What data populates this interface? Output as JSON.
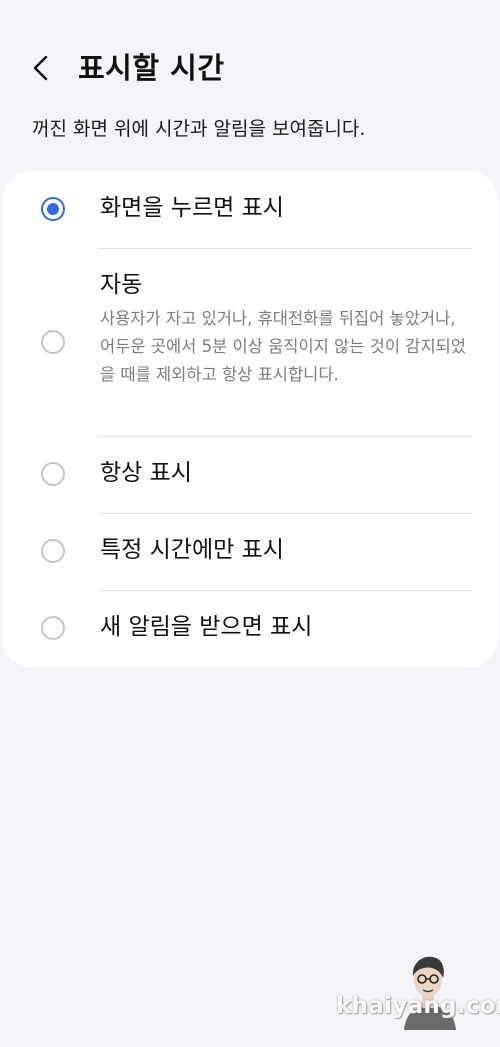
{
  "header": {
    "back_icon": "chevron-left-icon",
    "title": "표시할 시간"
  },
  "description": "꺼진 화면 위에 시간과 알림을 보여줍니다.",
  "options": [
    {
      "label": "화면을 누르면 표시",
      "selected": true
    },
    {
      "label": "자동",
      "sublabel": "사용자가 자고 있거나, 휴대전화를 뒤집어 놓았거나, 어두운 곳에서 5분 이상 움직이지 않는 것이 감지되었을 때를 제외하고 항상 표시합니다.",
      "selected": false
    },
    {
      "label": "항상 표시",
      "selected": false
    },
    {
      "label": "특정 시간에만 표시",
      "selected": false
    },
    {
      "label": "새 알림을 받으면 표시",
      "selected": false
    }
  ],
  "colors": {
    "accent": "#2f6ee0",
    "background": "#f5f4f9",
    "card": "#ffffff"
  },
  "watermark": "khaiyang.com"
}
